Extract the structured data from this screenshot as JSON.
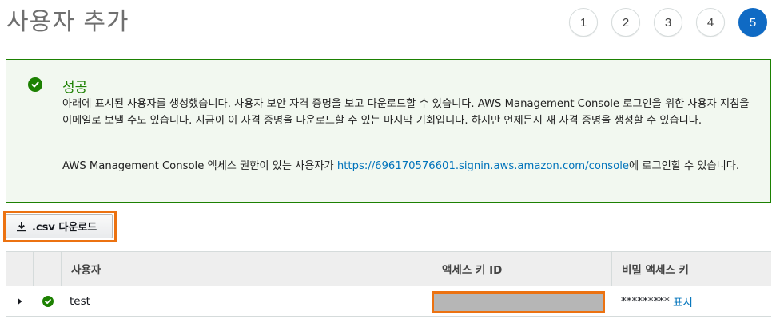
{
  "page": {
    "title": "사용자 추가"
  },
  "steps": [
    "1",
    "2",
    "3",
    "4",
    "5"
  ],
  "active_step": "5",
  "success": {
    "title": "성공",
    "message": "아래에 표시된 사용자를 생성했습니다. 사용자 보안 자격 증명을 보고 다운로드할 수 있습니다. AWS Management Console 로그인을 위한 사용자 지침을 이메일로 보낼 수도 있습니다. 지금이 이 자격 증명을 다운로드할 수 있는 마지막 기회입니다. 하지만 언제든지 새 자격 증명을 생성할 수 있습니다.",
    "console_prefix": "AWS Management Console 액세스 권한이 있는 사용자가 ",
    "console_link": "https://696170576601.signin.aws.amazon.com/console",
    "console_suffix": "에 로그인할 수 있습니다."
  },
  "toolbar": {
    "csv_label": ".csv 다운로드"
  },
  "table": {
    "headers": {
      "user": "사용자",
      "access_key": "액세스 키 ID",
      "secret_key": "비밀 액세스 키"
    },
    "rows": [
      {
        "user": "test",
        "access_key": "",
        "secret_masked": "*********",
        "show_label": "표시"
      }
    ]
  },
  "colors": {
    "success": "#1d8102",
    "highlight": "#ec7211",
    "link": "#0073bb",
    "active_step": "#0f6ac4"
  }
}
